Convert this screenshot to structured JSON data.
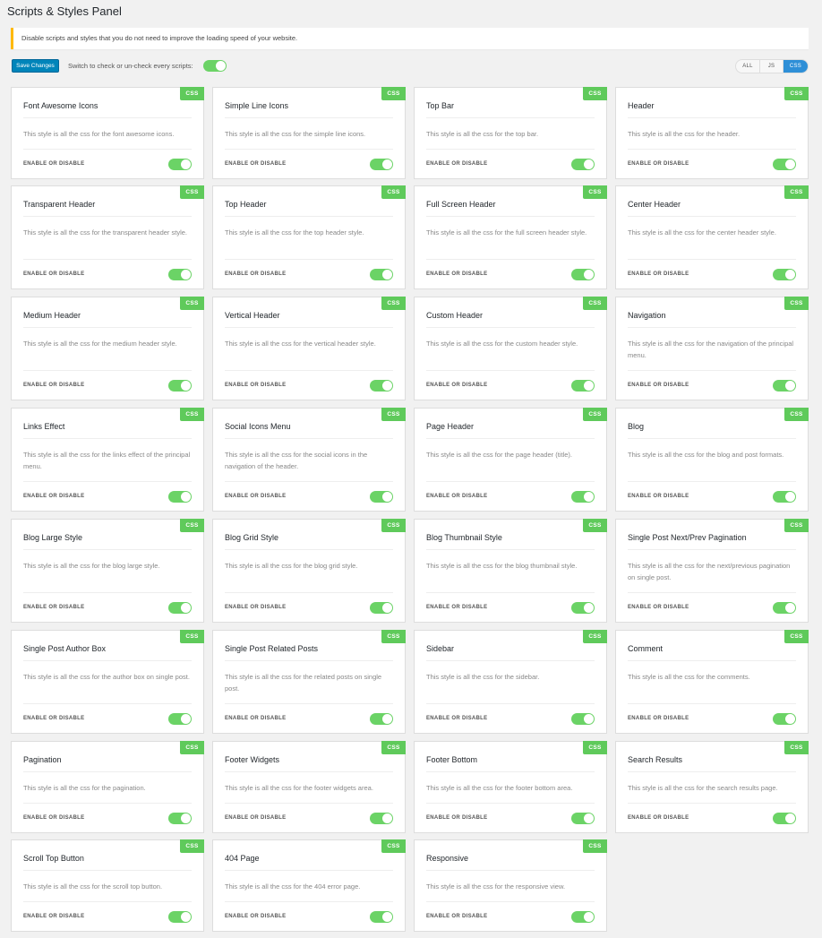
{
  "page": {
    "title": "Scripts & Styles Panel",
    "notice": "Disable scripts and styles that you do not need to improve the loading speed of your website."
  },
  "toolbar": {
    "save_label": "Save Changes",
    "switch_label": "Switch to check or un-check every scripts:",
    "master_toggle_on": true,
    "filters": [
      {
        "label": "ALL",
        "active": false
      },
      {
        "label": "JS",
        "active": false
      },
      {
        "label": "CSS",
        "active": true
      }
    ]
  },
  "colors": {
    "toggle_on": "#6bd366",
    "badge": "#5fca5b",
    "primary_button": "#0085ba",
    "filter_active": "#2e8fd7",
    "notice_border": "#ffb900"
  },
  "card_common": {
    "badge": "CSS",
    "toggle_label": "ENABLE OR DISABLE"
  },
  "cards": [
    {
      "title": "Font Awesome Icons",
      "desc": "This style is all the css for the font awesome icons.",
      "enabled": true
    },
    {
      "title": "Simple Line Icons",
      "desc": "This style is all the css for the simple line icons.",
      "enabled": true
    },
    {
      "title": "Top Bar",
      "desc": "This style is all the css for the top bar.",
      "enabled": true
    },
    {
      "title": "Header",
      "desc": "This style is all the css for the header.",
      "enabled": true
    },
    {
      "title": "Transparent Header",
      "desc": "This style is all the css for the transparent header style.",
      "enabled": true
    },
    {
      "title": "Top Header",
      "desc": "This style is all the css for the top header style.",
      "enabled": true
    },
    {
      "title": "Full Screen Header",
      "desc": "This style is all the css for the full screen header style.",
      "enabled": true
    },
    {
      "title": "Center Header",
      "desc": "This style is all the css for the center header style.",
      "enabled": true
    },
    {
      "title": "Medium Header",
      "desc": "This style is all the css for the medium header style.",
      "enabled": true
    },
    {
      "title": "Vertical Header",
      "desc": "This style is all the css for the vertical header style.",
      "enabled": true
    },
    {
      "title": "Custom Header",
      "desc": "This style is all the css for the custom header style.",
      "enabled": true
    },
    {
      "title": "Navigation",
      "desc": "This style is all the css for the navigation of the principal menu.",
      "enabled": true
    },
    {
      "title": "Links Effect",
      "desc": "This style is all the css for the links effect of the principal menu.",
      "enabled": true
    },
    {
      "title": "Social Icons Menu",
      "desc": "This style is all the css for the social icons in the navigation of the header.",
      "enabled": true
    },
    {
      "title": "Page Header",
      "desc": "This style is all the css for the page header (title).",
      "enabled": true
    },
    {
      "title": "Blog",
      "desc": "This style is all the css for the blog and post formats.",
      "enabled": true
    },
    {
      "title": "Blog Large Style",
      "desc": "This style is all the css for the blog large style.",
      "enabled": true
    },
    {
      "title": "Blog Grid Style",
      "desc": "This style is all the css for the blog grid style.",
      "enabled": true
    },
    {
      "title": "Blog Thumbnail Style",
      "desc": "This style is all the css for the blog thumbnail style.",
      "enabled": true
    },
    {
      "title": "Single Post Next/Prev Pagination",
      "desc": "This style is all the css for the next/previous pagination on single post.",
      "enabled": true
    },
    {
      "title": "Single Post Author Box",
      "desc": "This style is all the css for the author box on single post.",
      "enabled": true
    },
    {
      "title": "Single Post Related Posts",
      "desc": "This style is all the css for the related posts on single post.",
      "enabled": true
    },
    {
      "title": "Sidebar",
      "desc": "This style is all the css for the sidebar.",
      "enabled": true
    },
    {
      "title": "Comment",
      "desc": "This style is all the css for the comments.",
      "enabled": true
    },
    {
      "title": "Pagination",
      "desc": "This style is all the css for the pagination.",
      "enabled": true
    },
    {
      "title": "Footer Widgets",
      "desc": "This style is all the css for the footer widgets area.",
      "enabled": true
    },
    {
      "title": "Footer Bottom",
      "desc": "This style is all the css for the footer bottom area.",
      "enabled": true
    },
    {
      "title": "Search Results",
      "desc": "This style is all the css for the search results page.",
      "enabled": true
    },
    {
      "title": "Scroll Top Button",
      "desc": "This style is all the css for the scroll top button.",
      "enabled": true
    },
    {
      "title": "404 Page",
      "desc": "This style is all the css for the 404 error page.",
      "enabled": true
    },
    {
      "title": "Responsive",
      "desc": "This style is all the css for the responsive view.",
      "enabled": true
    }
  ]
}
